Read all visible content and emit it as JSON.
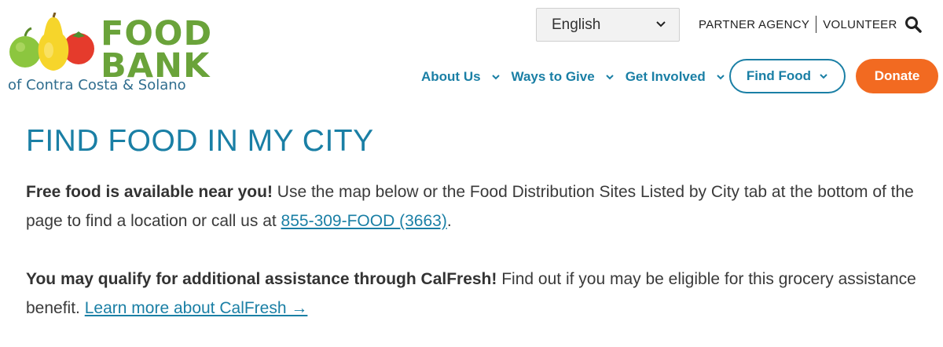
{
  "logo": {
    "line1": "FOOD",
    "line2": "BANK",
    "subtitle": "of Contra Costa & Solano"
  },
  "language_select": {
    "value": "English"
  },
  "utility_links": {
    "partner": "PARTNER AGENCY",
    "volunteer": "VOLUNTEER"
  },
  "nav": {
    "items": [
      {
        "label": "About Us"
      },
      {
        "label": "Ways to Give"
      },
      {
        "label": "Get Involved"
      }
    ],
    "find_food": "Find Food",
    "donate": "Donate"
  },
  "main": {
    "title": "FIND FOOD IN MY CITY",
    "para1": {
      "bold": "Free food is available near you!",
      "text": " Use the map below or the Food Distribution Sites Listed by City tab at the bottom of the page to find a location or call us at ",
      "link": "855-309-FOOD (3663)",
      "end": "."
    },
    "para2": {
      "bold": "You may qualify for additional assistance through CalFresh!",
      "text": " Find out if you may be eligible for this grocery assistance benefit. ",
      "link": "Learn more about CalFresh →"
    }
  },
  "colors": {
    "brand_blue": "#1a7fa5",
    "brand_green": "#6aa33a",
    "donate_orange": "#f26a21"
  }
}
